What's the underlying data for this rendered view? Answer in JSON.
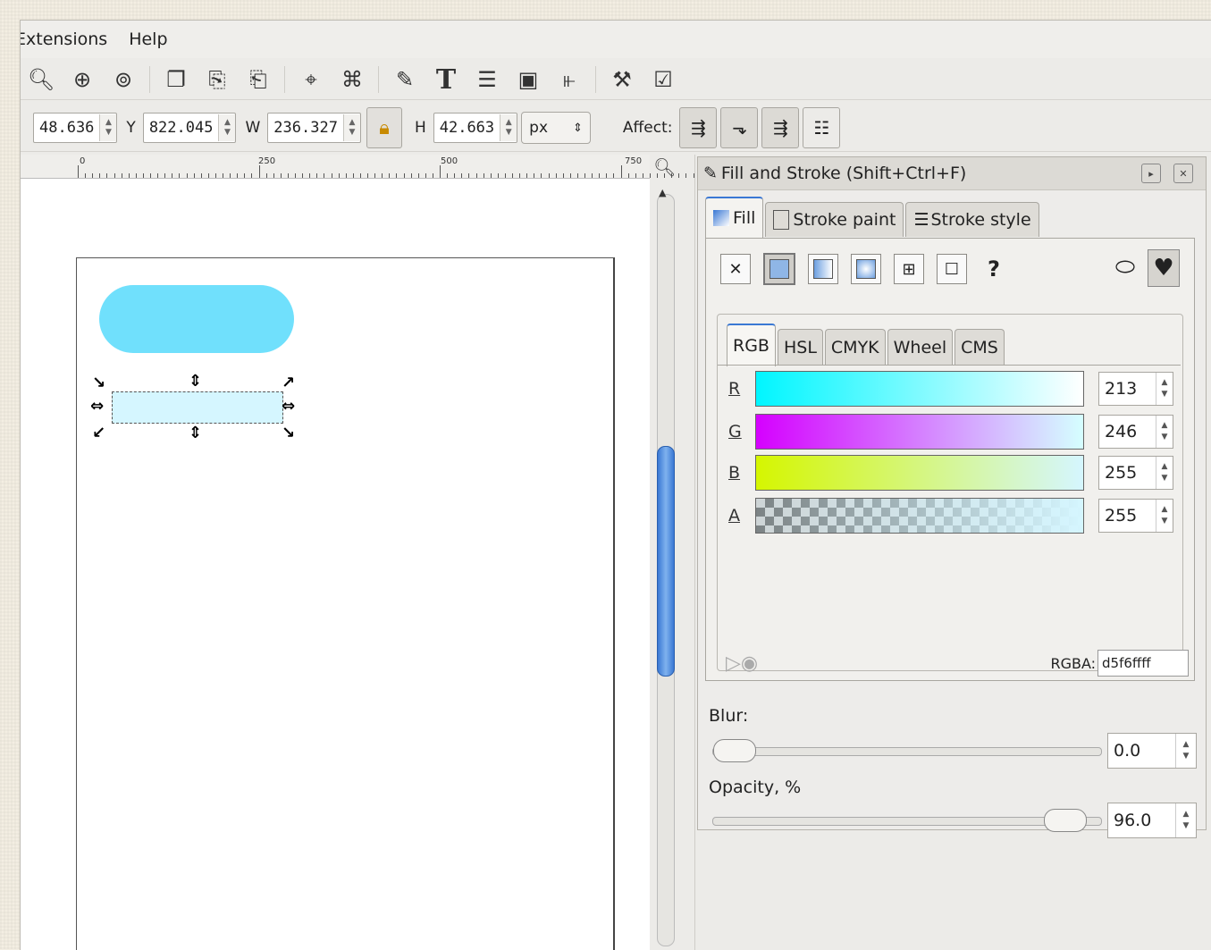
{
  "menubar": {
    "items": [
      "Extensions",
      "Help"
    ]
  },
  "coords": {
    "x": {
      "label": "",
      "value": "48.636"
    },
    "y": {
      "label": "Y",
      "value": "822.045"
    },
    "w": {
      "label": "W",
      "value": "236.327"
    },
    "h": {
      "label": "H",
      "value": "42.663"
    },
    "unit": "px",
    "affect_label": "Affect:"
  },
  "ruler": {
    "labels": [
      "0",
      "250",
      "500",
      "750"
    ]
  },
  "dialog": {
    "title": "Fill and Stroke (Shift+Ctrl+F)",
    "tabs": [
      "Fill",
      "Stroke paint",
      "Stroke style"
    ],
    "fill_type_unknown": "?",
    "flat_label": "Flat color",
    "color_tabs": [
      "RGB",
      "HSL",
      "CMYK",
      "Wheel",
      "CMS"
    ],
    "channels": [
      {
        "label": "R",
        "value": "213"
      },
      {
        "label": "G",
        "value": "246"
      },
      {
        "label": "B",
        "value": "255"
      },
      {
        "label": "A",
        "value": "255"
      }
    ],
    "rgba_label": "RGBA:",
    "rgba_value": "d5f6ffff",
    "blur_label": "Blur:",
    "blur_value": "0.0",
    "opacity_label": "Opacity, %",
    "opacity_value": "96.0"
  },
  "colors": {
    "pill_fill": "#70e0fc",
    "selected_fill": "#d5f6ff",
    "accent": "#3a78d4"
  },
  "icons": [
    "zoom-out-icon",
    "zoom-in-icon",
    "zoom-fit-icon",
    "copy-icon",
    "paste-icon",
    "paste-inplace-icon",
    "node-icon",
    "path-icon",
    "fill-stroke-icon",
    "text-icon",
    "layers-icon",
    "xml-icon",
    "align-icon",
    "preferences-icon",
    "document-props-icon",
    "lock-icon"
  ]
}
